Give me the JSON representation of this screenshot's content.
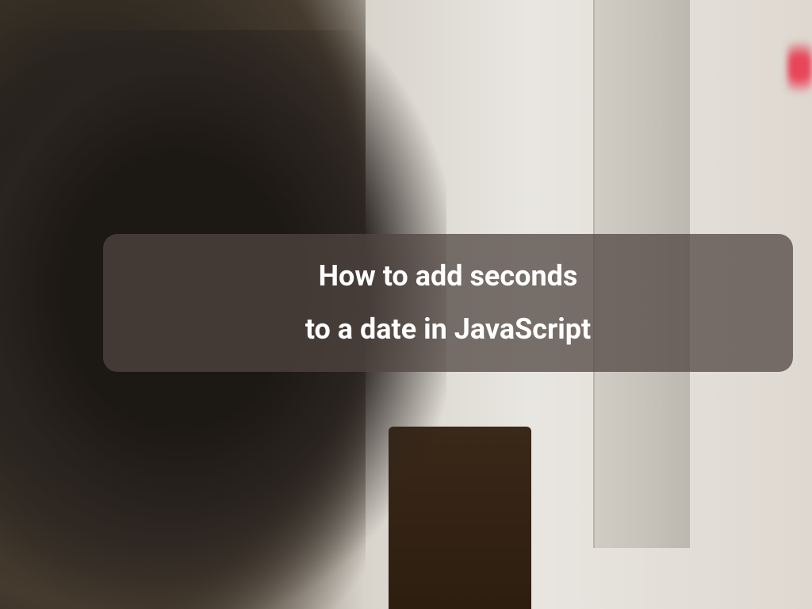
{
  "overlay": {
    "line1": "How to add seconds",
    "line2": "to a date in JavaScript"
  }
}
